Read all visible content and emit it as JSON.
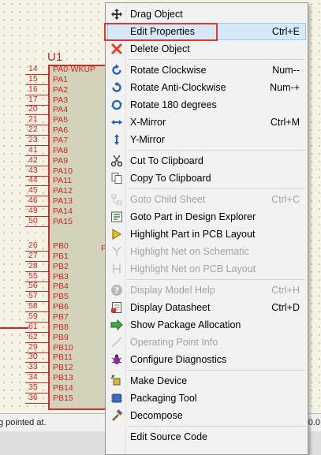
{
  "canvas": {
    "component_label": "U1",
    "stray_label": "P",
    "pins": [
      {
        "num": "14",
        "name": "PA0-WKUP"
      },
      {
        "num": "15",
        "name": "PA1"
      },
      {
        "num": "16",
        "name": "PA2"
      },
      {
        "num": "17",
        "name": "PA3"
      },
      {
        "num": "20",
        "name": "PA4"
      },
      {
        "num": "21",
        "name": "PA5"
      },
      {
        "num": "22",
        "name": "PA6"
      },
      {
        "num": "23",
        "name": "PA7"
      },
      {
        "num": "41",
        "name": "PA8"
      },
      {
        "num": "42",
        "name": "PA9"
      },
      {
        "num": "43",
        "name": "PA10"
      },
      {
        "num": "44",
        "name": "PA11"
      },
      {
        "num": "45",
        "name": "PA12"
      },
      {
        "num": "46",
        "name": "PA13"
      },
      {
        "num": "49",
        "name": "PA14"
      },
      {
        "num": "50",
        "name": "PA15"
      },
      {
        "num": "26",
        "name": "PB0"
      },
      {
        "num": "27",
        "name": "PB1"
      },
      {
        "num": "28",
        "name": "PB2"
      },
      {
        "num": "55",
        "name": "PB3"
      },
      {
        "num": "56",
        "name": "PB4"
      },
      {
        "num": "57",
        "name": "PB5"
      },
      {
        "num": "58",
        "name": "PB6"
      },
      {
        "num": "59",
        "name": "PB7"
      },
      {
        "num": "61",
        "name": "PB8"
      },
      {
        "num": "62",
        "name": "PB9"
      },
      {
        "num": "29",
        "name": "PB10"
      },
      {
        "num": "30",
        "name": "PB11"
      },
      {
        "num": "33",
        "name": "PB12"
      },
      {
        "num": "34",
        "name": "PB13"
      },
      {
        "num": "35",
        "name": "PB14"
      },
      {
        "num": "36",
        "name": "PB15"
      }
    ]
  },
  "status_bar": {
    "text": "g pointed at.",
    "right_text": "0.0"
  },
  "context_menu": {
    "groups": [
      [
        {
          "label": "Drag Object",
          "shortcut": "",
          "icon": "move-cross-icon",
          "enabled": true
        },
        {
          "label": "Edit Properties",
          "shortcut": "Ctrl+E",
          "icon": "",
          "enabled": true,
          "highlighted": true
        },
        {
          "label": "Delete Object",
          "shortcut": "",
          "icon": "red-x-icon",
          "enabled": true
        }
      ],
      [
        {
          "label": "Rotate Clockwise",
          "shortcut": "Num--",
          "icon": "rotate-cw-icon",
          "enabled": true
        },
        {
          "label": "Rotate Anti-Clockwise",
          "shortcut": "Num-+",
          "icon": "rotate-ccw-icon",
          "enabled": true
        },
        {
          "label": "Rotate 180 degrees",
          "shortcut": "",
          "icon": "rotate-180-icon",
          "enabled": true
        },
        {
          "label": "X-Mirror",
          "shortcut": "Ctrl+M",
          "icon": "x-mirror-icon",
          "enabled": true
        },
        {
          "label": "Y-Mirror",
          "shortcut": "",
          "icon": "y-mirror-icon",
          "enabled": true
        }
      ],
      [
        {
          "label": "Cut To Clipboard",
          "shortcut": "",
          "icon": "scissors-icon",
          "enabled": true
        },
        {
          "label": "Copy To Clipboard",
          "shortcut": "",
          "icon": "copy-icon",
          "enabled": true
        }
      ],
      [
        {
          "label": "Goto Child Sheet",
          "shortcut": "Ctrl+C",
          "icon": "child-sheet-icon",
          "enabled": false
        },
        {
          "label": "Goto Part in Design Explorer",
          "shortcut": "",
          "icon": "design-explorer-icon",
          "enabled": true
        },
        {
          "label": "Highlight Part in PCB Layout",
          "shortcut": "",
          "icon": "highlight-arrow-icon",
          "enabled": true
        },
        {
          "label": "Highlight Net on Schematic",
          "shortcut": "",
          "icon": "net-schematic-icon",
          "enabled": false
        },
        {
          "label": "Highlight Net on PCB Layout",
          "shortcut": "",
          "icon": "net-pcb-icon",
          "enabled": false
        }
      ],
      [
        {
          "label": "Display Model Help",
          "shortcut": "Ctrl+H",
          "icon": "help-icon",
          "enabled": false
        },
        {
          "label": "Display Datasheet",
          "shortcut": "Ctrl+D",
          "icon": "datasheet-icon",
          "enabled": true
        },
        {
          "label": "Show Package Allocation",
          "shortcut": "",
          "icon": "package-icon",
          "enabled": true
        },
        {
          "label": "Operating Point Info",
          "shortcut": "",
          "icon": "operating-point-icon",
          "enabled": false
        },
        {
          "label": "Configure Diagnostics",
          "shortcut": "",
          "icon": "bug-icon",
          "enabled": true
        }
      ],
      [
        {
          "label": "Make Device",
          "shortcut": "",
          "icon": "make-device-icon",
          "enabled": true
        },
        {
          "label": "Packaging Tool",
          "shortcut": "",
          "icon": "packaging-tool-icon",
          "enabled": true
        },
        {
          "label": "Decompose",
          "shortcut": "",
          "icon": "hammer-icon",
          "enabled": true
        }
      ],
      [
        {
          "label": "Edit Source Code",
          "shortcut": "",
          "icon": "",
          "enabled": true
        }
      ]
    ]
  }
}
